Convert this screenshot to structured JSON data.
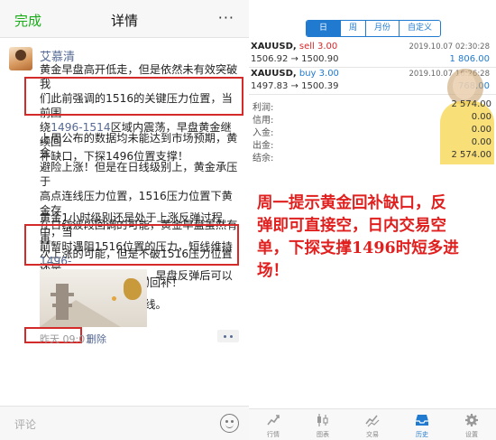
{
  "left": {
    "nav": {
      "done": "完成",
      "title": "详情",
      "more": "···"
    },
    "author": "艾慕清",
    "post": {
      "p1_l1": "黄金早盘高开低走，但是依然未有效突破我",
      "p1_l2": "们此前强调的1516的关键压力位置，当前围",
      "p1_l3_a": "绕",
      "p1_l3_link": "1496-1514",
      "p1_l3_b": "区域内震荡，早盘黄金继续回",
      "p1_l4": "补缺口，下探1496位置支撑！",
      "p2_l1": "上周公布的数据均未能达到市场预期，黄金",
      "p2_l2": "避险上涨！但是在日线级别上，黄金承压于",
      "p2_l3": "高点连线压力位置，1516压力位置下黄金存",
      "p2_l4": "在日线波段回调的可能，黄金早盘虽然有再",
      "p2_l5": "次上涨的可能，但是不破1516压力位置还是",
      "p2_l6": "继续看早盘跳空缺口的回补！",
      "p3_l1": "黄金1小时级别还是处于上涨反弹过程中，当",
      "p3_l2_a": "前暂时遇阻1516位置的压力，短线维持",
      "p3_l2_link": "1496-",
      "p3_l3_link": "1516",
      "p3_l3_b": "区域内盘整震荡，早盘反弹后可以直接",
      "p3_l4": "空，下看目标1496一线。"
    },
    "time": "昨天 09:01",
    "delete": "删除",
    "comment_placeholder": "评论"
  },
  "right": {
    "segments": [
      "日",
      "周",
      "月份",
      "自定义"
    ],
    "positions": [
      {
        "symbol": "XAUUSD,",
        "side": "sell 3.00",
        "time": "2019.10.07 02:30:28",
        "prices": "1506.92 → 1500.90",
        "pl": "1 806.00"
      },
      {
        "symbol": "XAUUSD,",
        "side": "buy 3.00",
        "time": "2019.10.07 16:26:28",
        "prices": "1497.83 → 1500.39",
        "pl": "768.00"
      }
    ],
    "stats": [
      {
        "label": "利润:",
        "value": "2 574.00"
      },
      {
        "label": "信用:",
        "value": "0.00"
      },
      {
        "label": "入金:",
        "value": "0.00"
      },
      {
        "label": "出金:",
        "value": "0.00"
      },
      {
        "label": "结余:",
        "value": "2 574.00"
      }
    ],
    "annotation": {
      "l1": "周一提示黄金回补缺口，反",
      "l2": "弹即可直接空，日内交易空",
      "l3": "单，下探支撑1496时短多进",
      "l4": "场！"
    },
    "tabs": [
      "行情",
      "图表",
      "交易",
      "历史",
      "设置"
    ],
    "colors": {
      "sell": "#d4282a",
      "buy": "#1f7ad0",
      "annotation": "#e0201f",
      "wechat_green": "#1aad19",
      "link": "#576b95"
    }
  }
}
